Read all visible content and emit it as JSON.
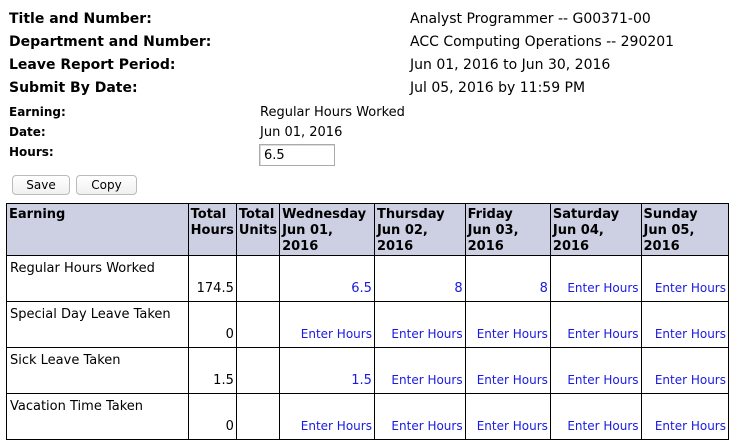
{
  "info": {
    "title_label": "Title and Number:",
    "title_value": "Analyst Programmer -- G00371-00",
    "dept_label": "Department and Number:",
    "dept_value": "ACC Computing Operations -- 290201",
    "period_label": "Leave Report Period:",
    "period_value": "Jun 01, 2016 to Jun 30, 2016",
    "submit_label": "Submit By Date:",
    "submit_value": "Jul 05, 2016 by 11:59 PM"
  },
  "form": {
    "earning_label": "Earning:",
    "earning_value": "Regular Hours Worked",
    "date_label": "Date:",
    "date_value": "Jun 01, 2016",
    "hours_label": "Hours:",
    "hours_value": "6.5",
    "save_label": "Save",
    "copy_label": "Copy"
  },
  "table": {
    "headers": [
      [
        "Earning"
      ],
      [
        "Total",
        "Hours"
      ],
      [
        "Total",
        "Units"
      ],
      [
        "Wednesday",
        "Jun 01,",
        "2016"
      ],
      [
        "Thursday",
        "Jun 02,",
        "2016"
      ],
      [
        "Friday",
        "Jun 03,",
        "2016"
      ],
      [
        "Saturday",
        "Jun 04,",
        "2016"
      ],
      [
        "Sunday",
        "Jun 05,",
        "2016"
      ]
    ],
    "rows": [
      {
        "earning": "Regular Hours Worked",
        "total_hours": "174.5",
        "total_units": "",
        "days": [
          "6.5",
          "8",
          "8",
          "Enter Hours",
          "Enter Hours"
        ]
      },
      {
        "earning": "Special Day Leave Taken",
        "total_hours": "0",
        "total_units": "",
        "days": [
          "Enter Hours",
          "Enter Hours",
          "Enter Hours",
          "Enter Hours",
          "Enter Hours"
        ]
      },
      {
        "earning": "Sick Leave Taken",
        "total_hours": "1.5",
        "total_units": "",
        "days": [
          "1.5",
          "Enter Hours",
          "Enter Hours",
          "Enter Hours",
          "Enter Hours"
        ]
      },
      {
        "earning": "Vacation Time Taken",
        "total_hours": "0",
        "total_units": "",
        "days": [
          "Enter Hours",
          "Enter Hours",
          "Enter Hours",
          "Enter Hours",
          "Enter Hours"
        ]
      }
    ]
  }
}
